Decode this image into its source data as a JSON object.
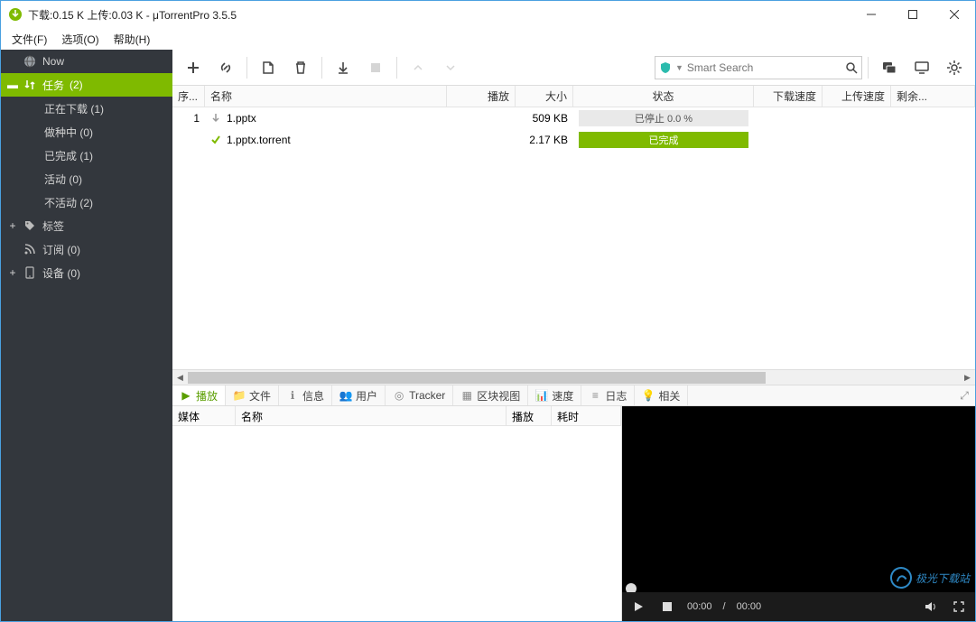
{
  "window": {
    "title": "下载:0.15 K 上传:0.03 K - μTorrentPro 3.5.5"
  },
  "menu": {
    "file": "文件(F)",
    "options": "选项(O)",
    "help": "帮助(H)"
  },
  "sidebar": {
    "now": "Now",
    "tasks_label": "任务",
    "tasks_count": "(2)",
    "downloading": "正在下载 (1)",
    "seeding": "做种中 (0)",
    "completed": "已完成 (1)",
    "active": "活动 (0)",
    "inactive": "不活动 (2)",
    "labels": "标签",
    "feeds": "订阅 (0)",
    "devices": "设备 (0)"
  },
  "search": {
    "placeholder": "Smart Search"
  },
  "columns": {
    "seq": "序...",
    "name": "名称",
    "play": "播放",
    "size": "大小",
    "status": "状态",
    "down_speed": "下载速度",
    "up_speed": "上传速度",
    "remaining": "剩余..."
  },
  "rows": [
    {
      "seq": "1",
      "name": "1.pptx",
      "size": "509 KB",
      "status": "已停止 0.0 %",
      "status_kind": "stopped",
      "icon": "down"
    },
    {
      "seq": "",
      "name": "1.pptx.torrent",
      "size": "2.17 KB",
      "status": "已完成",
      "status_kind": "done",
      "icon": "check"
    }
  ],
  "detail_tabs": {
    "play": "播放",
    "files": "文件",
    "info": "信息",
    "users": "用户",
    "tracker": "Tracker",
    "pieces": "区块视图",
    "speed": "速度",
    "log": "日志",
    "related": "相关"
  },
  "detail_cols": {
    "media": "媒体",
    "name": "名称",
    "play": "播放",
    "elapsed": "耗时"
  },
  "player": {
    "cur": "00:00",
    "sep": "/",
    "dur": "00:00"
  },
  "watermark": "极光下载站"
}
